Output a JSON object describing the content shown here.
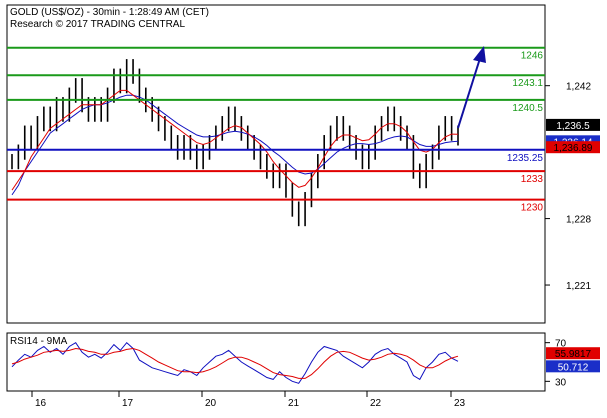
{
  "chart_data": {
    "type": "line",
    "title": "GOLD (US$/OZ) - 30min - 1:28:49 AM (CET)",
    "subtitle": "Research © 2017 TRADING CENTRAL",
    "x_ticks": [
      "16",
      "17",
      "20",
      "21",
      "22",
      "23"
    ],
    "price_axis": {
      "ticks": [
        {
          "label": "1,242",
          "value": 1242
        },
        {
          "label": "1,228",
          "value": 1228
        },
        {
          "label": "1,221",
          "value": 1221
        }
      ],
      "ylim": [
        1217.0,
        1250.5
      ]
    },
    "levels": [
      {
        "label": "1246",
        "value": 1246.0,
        "color": "#1a9a1a"
      },
      {
        "label": "1243.1",
        "value": 1243.1,
        "color": "#1a9a1a"
      },
      {
        "label": "1240.5",
        "value": 1240.5,
        "color": "#1a9a1a"
      },
      {
        "label": "1235.25",
        "value": 1235.25,
        "color": "#1010c0"
      },
      {
        "label": "1233",
        "value": 1233.0,
        "color": "#e00000"
      },
      {
        "label": "1230",
        "value": 1230.0,
        "color": "#e00000"
      }
    ],
    "price_markers": [
      {
        "label": "1,236.5",
        "value": 1236.5,
        "bg": "#000000",
        "fg": "#ffffff"
      },
      {
        "label": "1,236.14",
        "value": 1236.14,
        "bg": "#1a2ec8",
        "fg": "#ffffff"
      },
      {
        "label": "1,236.89",
        "value": 1236.89,
        "bg": "#e00000",
        "fg": "#000000"
      }
    ],
    "price_series": [
      1234,
      1235,
      1237,
      1236,
      1238,
      1239,
      1238,
      1240,
      1239,
      1241,
      1242,
      1240,
      1239,
      1240,
      1239,
      1241,
      1243,
      1242,
      1244,
      1243,
      1241,
      1240,
      1239,
      1238,
      1237,
      1236,
      1235,
      1236,
      1235,
      1234,
      1235,
      1236,
      1237,
      1238,
      1239,
      1238,
      1237,
      1236,
      1235,
      1234,
      1233,
      1232,
      1233,
      1231,
      1229,
      1228,
      1230,
      1232,
      1234,
      1236,
      1237,
      1238,
      1237,
      1236,
      1235,
      1234,
      1235,
      1237,
      1238,
      1239,
      1238,
      1237,
      1236,
      1233,
      1232,
      1234,
      1235,
      1237,
      1238,
      1237,
      1236.5
    ],
    "series": [
      {
        "name": "",
        "color": "#1010c0",
        "values": [
          1230.5,
          1231.5,
          1233,
          1234,
          1235,
          1236,
          1237,
          1237.5,
          1238,
          1238.5,
          1239,
          1239.5,
          1239.8,
          1240,
          1240,
          1240.2,
          1240.5,
          1240.8,
          1241,
          1241,
          1240.8,
          1240.5,
          1240,
          1239.5,
          1239,
          1238.5,
          1238,
          1237.6,
          1237.2,
          1236.8,
          1236.6,
          1236.6,
          1236.7,
          1236.9,
          1237.1,
          1237.2,
          1237.1,
          1236.9,
          1236.6,
          1236.2,
          1235.7,
          1235.1,
          1234.6,
          1234,
          1233.4,
          1232.9,
          1232.7,
          1232.8,
          1233.2,
          1233.8,
          1234.4,
          1235,
          1235.4,
          1235.7,
          1235.9,
          1235.9,
          1235.8,
          1235.9,
          1236.1,
          1236.4,
          1236.6,
          1236.7,
          1236.6,
          1236.2,
          1235.8,
          1235.6,
          1235.6,
          1235.8,
          1236,
          1236.1,
          1236.14
        ]
      },
      {
        "name": "",
        "color": "#e00000",
        "values": [
          1231,
          1232,
          1233,
          1234.5,
          1235.5,
          1236.5,
          1237.5,
          1238,
          1238.5,
          1239,
          1239.5,
          1240,
          1240,
          1240,
          1240,
          1240.5,
          1241,
          1241.5,
          1241.5,
          1241,
          1240.5,
          1240,
          1239.5,
          1239,
          1238.5,
          1238,
          1237.5,
          1237,
          1236.5,
          1236,
          1235.8,
          1236,
          1236.5,
          1237,
          1237.5,
          1237.8,
          1237.6,
          1237,
          1236.4,
          1235.8,
          1235,
          1234,
          1233.2,
          1232.5,
          1231.8,
          1231.3,
          1231.5,
          1232.3,
          1233.3,
          1234.5,
          1235.6,
          1236.4,
          1236.8,
          1236.8,
          1236.5,
          1236.2,
          1236.3,
          1236.9,
          1237.6,
          1238,
          1238,
          1237.7,
          1237.1,
          1236.1,
          1235.2,
          1235,
          1235.3,
          1236,
          1236.6,
          1236.9,
          1236.89
        ]
      }
    ],
    "rsi": {
      "label": "RSI14 - 9MA",
      "ticks": [
        {
          "label": "70",
          "value": 70
        },
        {
          "label": "30",
          "value": 30
        }
      ],
      "ylim": [
        20,
        80
      ],
      "markers": [
        {
          "label": "55.9817",
          "value": 55.9817,
          "bg": "#e00000",
          "fg": "#000000"
        },
        {
          "label": "50.712",
          "value": 50.712,
          "bg": "#1a2ec8",
          "fg": "#ffffff"
        }
      ],
      "series": [
        {
          "name": "",
          "color": "#1010c0",
          "values": [
            45,
            52,
            58,
            55,
            62,
            66,
            60,
            64,
            58,
            66,
            70,
            60,
            55,
            58,
            54,
            60,
            68,
            62,
            70,
            64,
            52,
            48,
            44,
            42,
            40,
            38,
            36,
            42,
            40,
            36,
            44,
            50,
            56,
            58,
            62,
            56,
            50,
            46,
            42,
            38,
            34,
            32,
            40,
            34,
            30,
            28,
            38,
            50,
            60,
            66,
            64,
            62,
            56,
            52,
            48,
            44,
            50,
            58,
            62,
            64,
            58,
            54,
            50,
            36,
            32,
            44,
            50,
            58,
            60,
            54,
            50.712
          ]
        },
        {
          "name": "",
          "color": "#e00000",
          "values": [
            48,
            50,
            53,
            55,
            57,
            60,
            61,
            62,
            61,
            62,
            64,
            63,
            61,
            60,
            58,
            58,
            60,
            61,
            63,
            64,
            62,
            58,
            54,
            50,
            47,
            44,
            41,
            40,
            40,
            39,
            40,
            42,
            45,
            49,
            53,
            55,
            55,
            53,
            50,
            47,
            43,
            39,
            37,
            36,
            35,
            33,
            33,
            37,
            43,
            50,
            56,
            60,
            61,
            60,
            57,
            54,
            52,
            53,
            55,
            58,
            59,
            58,
            56,
            52,
            47,
            44,
            44,
            47,
            51,
            54,
            55.9817
          ]
        }
      ]
    }
  }
}
